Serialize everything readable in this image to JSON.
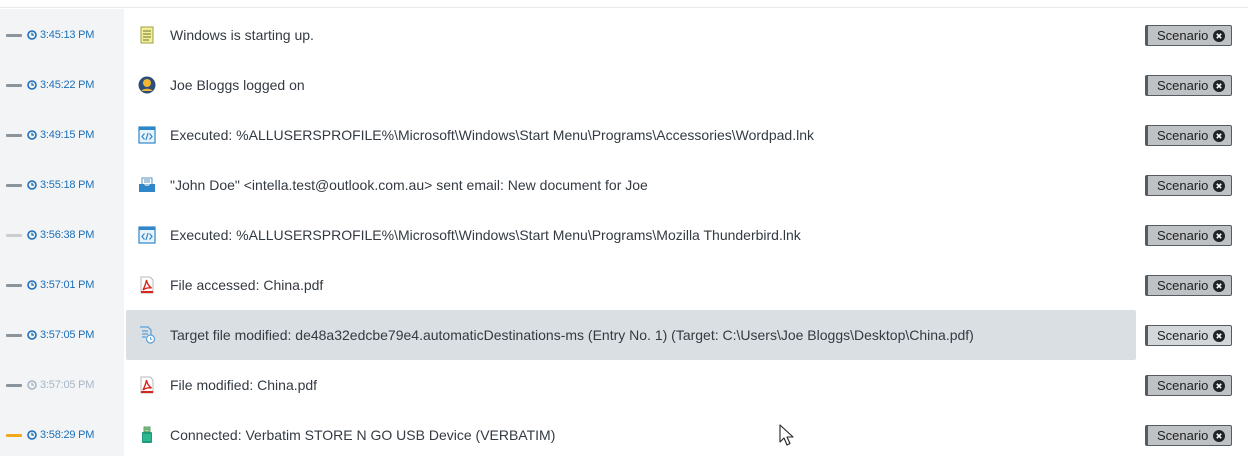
{
  "tag_label": "Scenario",
  "colors": {
    "time_blue": "#1d6fb8",
    "tick_gray": "#8b939b",
    "tick_orange": "#f0a81c",
    "selected_bg": "#dadfe4",
    "tag_bg": "#bfc2c5"
  },
  "events": [
    {
      "time": "3:45:13 PM",
      "icon": "notepad-icon",
      "text": "Windows is starting up."
    },
    {
      "time": "3:45:22 PM",
      "icon": "user-logon-icon",
      "text": "Joe Bloggs logged on"
    },
    {
      "time": "3:49:15 PM",
      "icon": "code-icon",
      "text": "Executed: %ALLUSERSPROFILE%\\Microsoft\\Windows\\Start Menu\\Programs\\Accessories\\Wordpad.lnk"
    },
    {
      "time": "3:55:18 PM",
      "icon": "email-inbox-icon",
      "text": "\"John Doe\" <intella.test@outlook.com.au> sent email: New document for Joe"
    },
    {
      "time": "3:56:38 PM",
      "icon": "code-icon",
      "text": "Executed: %ALLUSERSPROFILE%\\Microsoft\\Windows\\Start Menu\\Programs\\Mozilla Thunderbird.lnk"
    },
    {
      "time": "3:57:01 PM",
      "icon": "pdf-icon",
      "text": "File accessed: China.pdf"
    },
    {
      "time": "3:57:05 PM",
      "icon": "file-history-icon",
      "text": "Target file modified: de48a32edcbe79e4.automaticDestinations-ms (Entry No. 1) (Target: C:\\Users\\Joe Bloggs\\Desktop\\China.pdf)",
      "selected": true
    },
    {
      "time": "3:57:05 PM",
      "icon": "pdf-icon",
      "text": "File modified: China.pdf"
    },
    {
      "time": "3:58:29 PM",
      "icon": "usb-drive-icon",
      "text": "Connected: Verbatim STORE N GO USB Device (VERBATIM)"
    }
  ]
}
